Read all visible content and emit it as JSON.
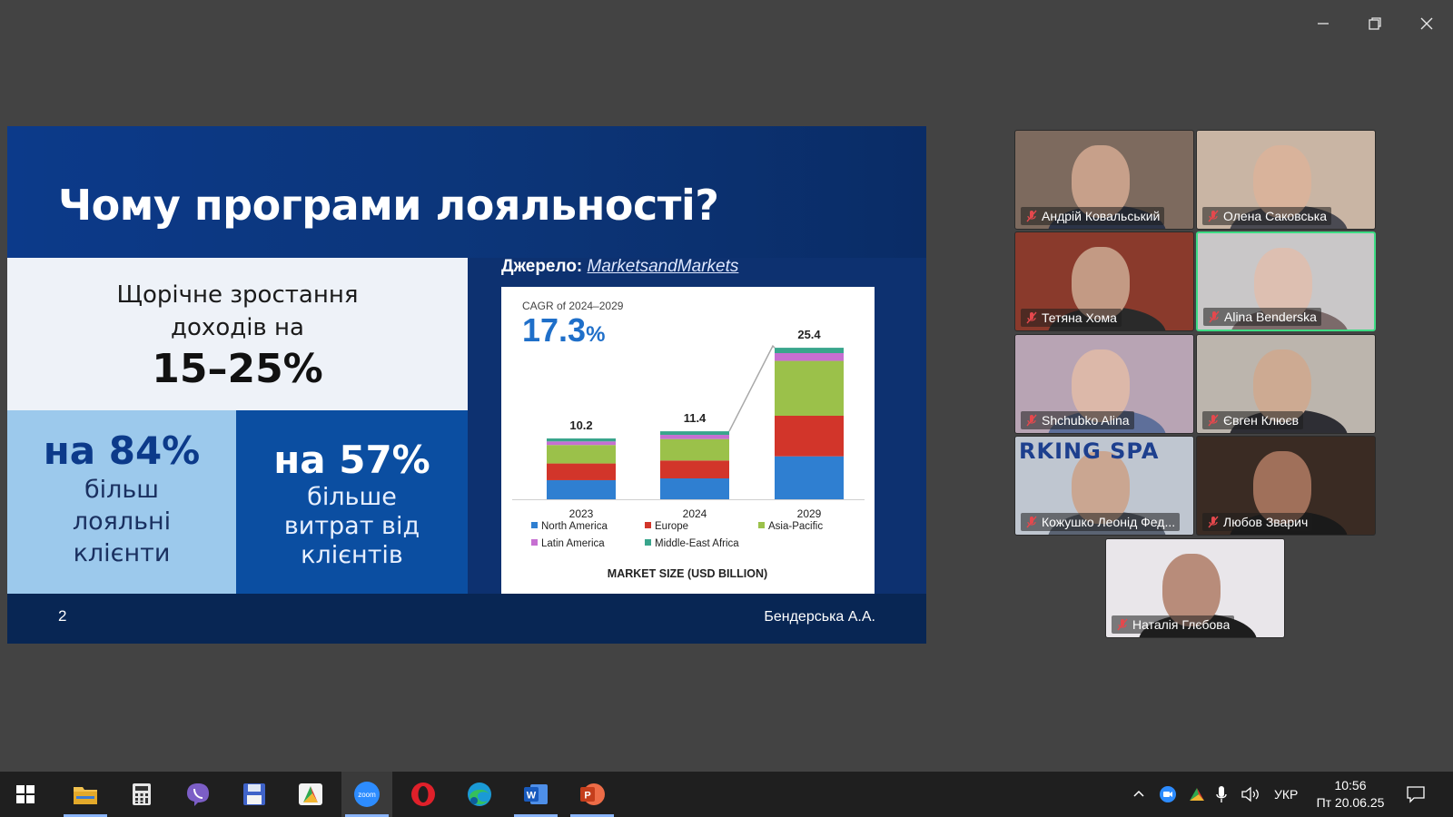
{
  "window": {
    "minimize_icon": "minimize-icon",
    "restore_icon": "restore-icon",
    "close_icon": "close-icon"
  },
  "slide": {
    "title": "Чому програми лояльності?",
    "growth_line1": "Щорічне зростання",
    "growth_line2": "доходів на",
    "growth_value": "15–25%",
    "loyal_value": "на 84%",
    "loyal_line1": "більш",
    "loyal_line2": "лояльні",
    "loyal_line3": "клієнти",
    "spend_value": "на 57%",
    "spend_line1": "більше",
    "spend_line2": "витрат від",
    "spend_line3": "клієнтів",
    "source_label": "Джерело:",
    "source_link": "MarketsandMarkets",
    "page_number": "2",
    "author": "Бендерська А.А."
  },
  "chart_data": {
    "type": "bar",
    "stacked": true,
    "cagr_label": "CAGR of 2024–2029",
    "cagr_value": "17.3",
    "cagr_unit": "%",
    "categories": [
      "2023",
      "2024",
      "2029"
    ],
    "totals": [
      10.2,
      11.4,
      25.4
    ],
    "total_labels": [
      "10.2",
      "11.4",
      "25.4"
    ],
    "series": [
      {
        "name": "North America",
        "color": "#2f7fd1",
        "values": [
          3.2,
          3.5,
          7.2
        ]
      },
      {
        "name": "Europe",
        "color": "#d2352a",
        "values": [
          2.8,
          3.0,
          6.8
        ]
      },
      {
        "name": "Asia-Pacific",
        "color": "#9bc14a",
        "values": [
          3.1,
          3.6,
          9.2
        ]
      },
      {
        "name": "Latin America",
        "color": "#c66fd1",
        "values": [
          0.6,
          0.7,
          1.3
        ]
      },
      {
        "name": "Middle-East Africa",
        "color": "#39a58c",
        "values": [
          0.5,
          0.6,
          0.9
        ]
      }
    ],
    "ylim": [
      0,
      28
    ],
    "xlabel": "MARKET SIZE (USD BILLION)",
    "legend_position": "bottom"
  },
  "participants": [
    {
      "name": "Андрій Ковальський",
      "bg": "#7d6a5e",
      "skin": "#c7a08a",
      "shirt": "#2c3448",
      "active": false
    },
    {
      "name": "Олена Саковська",
      "bg": "#c9b5a4",
      "skin": "#d9b39b",
      "shirt": "#4a4a52",
      "active": false
    },
    {
      "name": "Тетяна Хома",
      "bg": "#8a3a2c",
      "skin": "#c39a84",
      "shirt": "#2a2a2a",
      "active": false
    },
    {
      "name": "Alina Benderska",
      "bg": "#c9c7c8",
      "skin": "#ddbfb1",
      "shirt": "#7b6a6a",
      "active": true
    },
    {
      "name": "Shchubko Alina",
      "bg": "#b8a4b4",
      "skin": "#dcb8a9",
      "shirt": "#5e6f9a",
      "active": false
    },
    {
      "name": "Євген Клюєв",
      "bg": "#bcb5ad",
      "skin": "#cdaa92",
      "shirt": "#2e2e34",
      "active": false
    },
    {
      "name": "Кожушко Леонід Фед...",
      "bg": "#bfc6d0",
      "skin": "#caa691",
      "shirt": "#5b6473",
      "active": false,
      "banner": "RKING SPA"
    },
    {
      "name": "Любов Зварич",
      "bg": "#3a2b23",
      "skin": "#a0705a",
      "shirt": "#1a1a1a",
      "active": false
    },
    {
      "name": "Наталія Глєбова",
      "bg": "#e9e6ea",
      "skin": "#b88c7a",
      "shirt": "#1d1d1d",
      "active": false
    }
  ],
  "taskbar": {
    "apps": [
      {
        "name": "start",
        "icon": "windows-icon"
      },
      {
        "name": "file-explorer",
        "icon": "folder-icon"
      },
      {
        "name": "calculator",
        "icon": "calculator-icon"
      },
      {
        "name": "viber",
        "icon": "viber-icon"
      },
      {
        "name": "save-app",
        "icon": "floppy-icon"
      },
      {
        "name": "app-logo",
        "icon": "logo-icon"
      },
      {
        "name": "zoom",
        "icon": "zoom-icon",
        "label": "zoom"
      },
      {
        "name": "opera",
        "icon": "opera-icon"
      },
      {
        "name": "edge",
        "icon": "edge-icon"
      },
      {
        "name": "word",
        "icon": "word-icon",
        "label": "W"
      },
      {
        "name": "powerpoint",
        "icon": "powerpoint-icon",
        "label": "P"
      }
    ],
    "language": "УКР",
    "time": "10:56",
    "date": "Пт 20.06.25"
  }
}
